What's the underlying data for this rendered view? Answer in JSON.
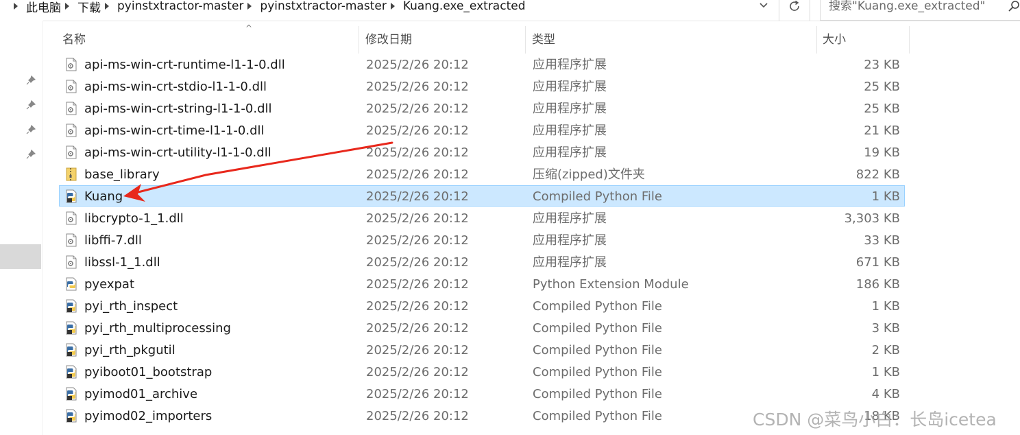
{
  "address_bar": {
    "breadcrumbs": [
      "此电脑",
      "下载",
      "pyinstxtractor-master",
      "pyinstxtractor-master",
      "Kuang.exe_extracted"
    ]
  },
  "search": {
    "placeholder": "搜索\"Kuang.exe_extracted\""
  },
  "columns": {
    "name": "名称",
    "date": "修改日期",
    "type": "类型",
    "size": "大小"
  },
  "files": [
    {
      "name": "api-ms-win-crt-runtime-l1-1-0.dll",
      "date": "2025/2/26 20:12",
      "type": "应用程序扩展",
      "size": "23 KB",
      "icon": "dll-file-icon"
    },
    {
      "name": "api-ms-win-crt-stdio-l1-1-0.dll",
      "date": "2025/2/26 20:12",
      "type": "应用程序扩展",
      "size": "25 KB",
      "icon": "dll-file-icon"
    },
    {
      "name": "api-ms-win-crt-string-l1-1-0.dll",
      "date": "2025/2/26 20:12",
      "type": "应用程序扩展",
      "size": "25 KB",
      "icon": "dll-file-icon"
    },
    {
      "name": "api-ms-win-crt-time-l1-1-0.dll",
      "date": "2025/2/26 20:12",
      "type": "应用程序扩展",
      "size": "21 KB",
      "icon": "dll-file-icon"
    },
    {
      "name": "api-ms-win-crt-utility-l1-1-0.dll",
      "date": "2025/2/26 20:12",
      "type": "应用程序扩展",
      "size": "19 KB",
      "icon": "dll-file-icon"
    },
    {
      "name": "base_library",
      "date": "2025/2/26 20:12",
      "type": "压缩(zipped)文件夹",
      "size": "822 KB",
      "icon": "zip-folder-icon"
    },
    {
      "name": "Kuang",
      "date": "2025/2/26 20:12",
      "type": "Compiled Python File",
      "size": "1 KB",
      "icon": "python-compiled-icon",
      "selected": true
    },
    {
      "name": "libcrypto-1_1.dll",
      "date": "2025/2/26 20:12",
      "type": "应用程序扩展",
      "size": "3,303 KB",
      "icon": "dll-file-icon"
    },
    {
      "name": "libffi-7.dll",
      "date": "2025/2/26 20:12",
      "type": "应用程序扩展",
      "size": "33 KB",
      "icon": "dll-file-icon"
    },
    {
      "name": "libssl-1_1.dll",
      "date": "2025/2/26 20:12",
      "type": "应用程序扩展",
      "size": "671 KB",
      "icon": "dll-file-icon"
    },
    {
      "name": "pyexpat",
      "date": "2025/2/26 20:12",
      "type": "Python Extension Module",
      "size": "186 KB",
      "icon": "python-extension-icon"
    },
    {
      "name": "pyi_rth_inspect",
      "date": "2025/2/26 20:12",
      "type": "Compiled Python File",
      "size": "1 KB",
      "icon": "python-compiled-icon"
    },
    {
      "name": "pyi_rth_multiprocessing",
      "date": "2025/2/26 20:12",
      "type": "Compiled Python File",
      "size": "3 KB",
      "icon": "python-compiled-icon"
    },
    {
      "name": "pyi_rth_pkgutil",
      "date": "2025/2/26 20:12",
      "type": "Compiled Python File",
      "size": "2 KB",
      "icon": "python-compiled-icon"
    },
    {
      "name": "pyiboot01_bootstrap",
      "date": "2025/2/26 20:12",
      "type": "Compiled Python File",
      "size": "1 KB",
      "icon": "python-compiled-icon"
    },
    {
      "name": "pyimod01_archive",
      "date": "2025/2/26 20:12",
      "type": "Compiled Python File",
      "size": "4 KB",
      "icon": "python-compiled-icon"
    },
    {
      "name": "pyimod02_importers",
      "date": "2025/2/26 20:12",
      "type": "Compiled Python File",
      "size": "18 KB",
      "icon": "python-compiled-icon"
    }
  ],
  "watermark": "CSDN @菜鸟小白：长岛icetea",
  "colors": {
    "selection_bg": "#cce8ff",
    "selection_border": "#99d1ff",
    "annotation_arrow": "#e8281c"
  }
}
